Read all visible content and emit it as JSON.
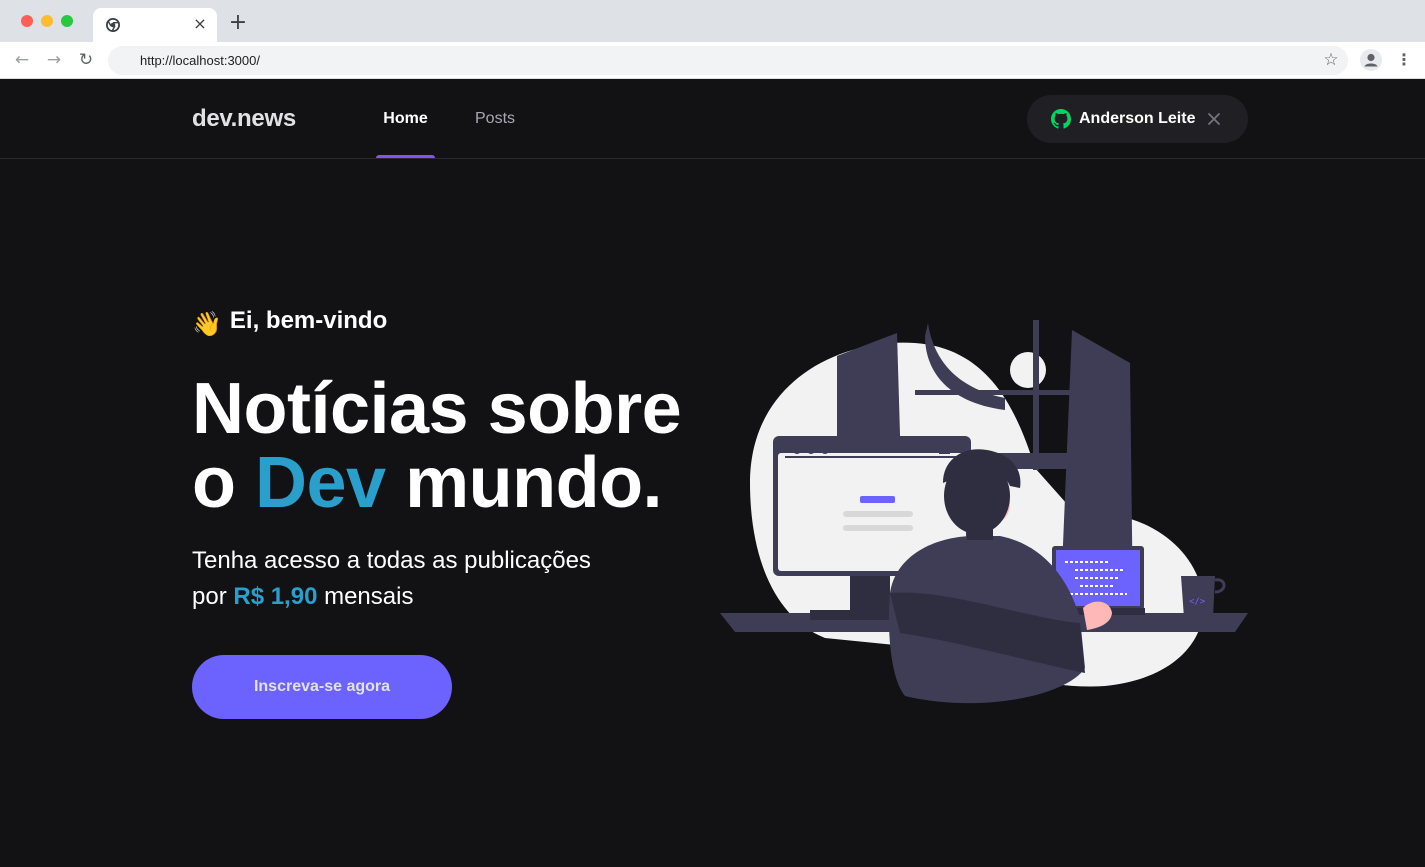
{
  "browser": {
    "url": "http://localhost:3000/",
    "tab_close": "×",
    "new_tab": "+"
  },
  "header": {
    "logo": "dev.news",
    "nav": [
      {
        "label": "Home",
        "active": true
      },
      {
        "label": "Posts",
        "active": false
      }
    ],
    "signin": {
      "user_name": "Anderson Leite",
      "icon": "github-icon",
      "icon_color": "#04d361"
    }
  },
  "hero": {
    "greeting_emoji": "👋",
    "greeting": "Ei, bem-vindo",
    "headline_line1": "Notícias sobre",
    "headline_line2_prefix": "o",
    "headline_accent": "Dev",
    "headline_line2_suffix": "mundo.",
    "sub_line1": "Tenha acesso a todas as publicações",
    "sub_prefix": "por",
    "price": "R$ 1,90",
    "sub_suffix": "mensais",
    "cta_label": "Inscreva-se agora"
  },
  "colors": {
    "background": "#121214",
    "accent_cyan": "#2a9fcc",
    "accent_purple": "#6c63ff",
    "nav_active": "#8257e5"
  }
}
